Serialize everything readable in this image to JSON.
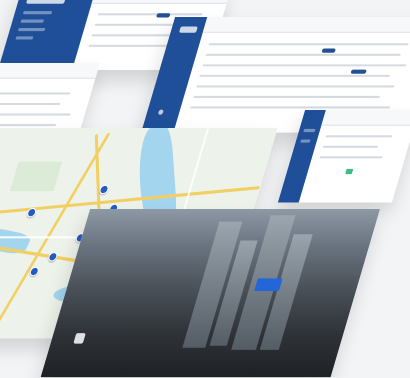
{
  "scene": {
    "brand_color": "#1f4f98",
    "accent_color": "#2266d7",
    "map_water_color": "#9fd3ef",
    "map_road_color": "#f2cf63",
    "success_color": "#3dbb8a"
  },
  "icons": {
    "map_pin": "map-pin-icon",
    "gear": "gear-icon",
    "logo": "logo-icon"
  }
}
